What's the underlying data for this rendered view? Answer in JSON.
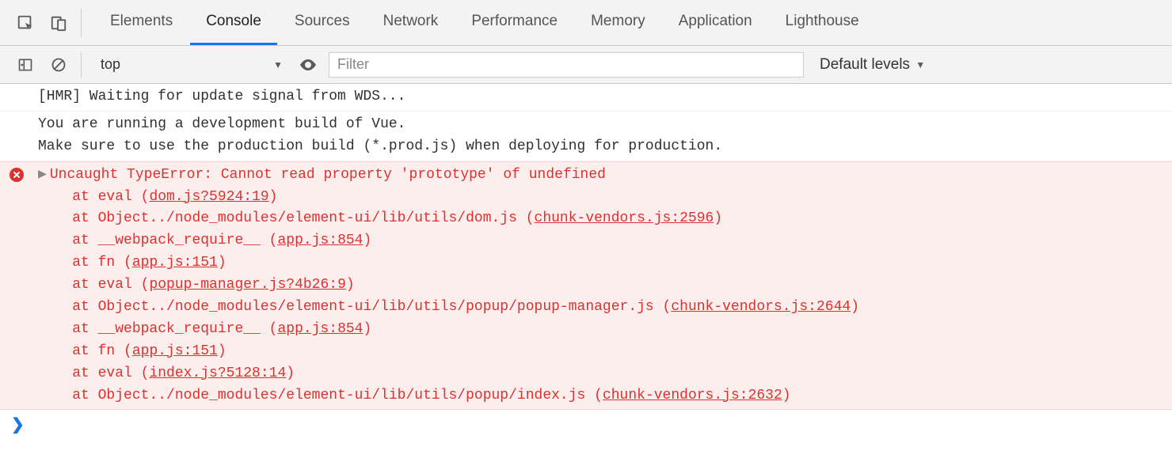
{
  "tabs": [
    "Elements",
    "Console",
    "Sources",
    "Network",
    "Performance",
    "Memory",
    "Application",
    "Lighthouse"
  ],
  "active_tab": "Console",
  "subbar": {
    "context": "top",
    "filter_placeholder": "Filter",
    "levels_label": "Default levels"
  },
  "logs": [
    {
      "type": "log",
      "lines": [
        "[HMR] Waiting for update signal from WDS..."
      ]
    },
    {
      "type": "log",
      "lines": [
        "You are running a development build of Vue.",
        "Make sure to use the production build (*.prod.js) when deploying for production."
      ]
    },
    {
      "type": "error",
      "header": "Uncaught TypeError: Cannot read property 'prototype' of undefined",
      "stack": [
        {
          "prefix": "at eval (",
          "link": "dom.js?5924:19",
          "suffix": ")"
        },
        {
          "prefix": "at Object../node_modules/element-ui/lib/utils/dom.js (",
          "link": "chunk-vendors.js:2596",
          "suffix": ")"
        },
        {
          "prefix": "at __webpack_require__ (",
          "link": "app.js:854",
          "suffix": ")"
        },
        {
          "prefix": "at fn (",
          "link": "app.js:151",
          "suffix": ")"
        },
        {
          "prefix": "at eval (",
          "link": "popup-manager.js?4b26:9",
          "suffix": ")"
        },
        {
          "prefix": "at Object../node_modules/element-ui/lib/utils/popup/popup-manager.js (",
          "link": "chunk-vendors.js:2644",
          "suffix": ")"
        },
        {
          "prefix": "at __webpack_require__ (",
          "link": "app.js:854",
          "suffix": ")"
        },
        {
          "prefix": "at fn (",
          "link": "app.js:151",
          "suffix": ")"
        },
        {
          "prefix": "at eval (",
          "link": "index.js?5128:14",
          "suffix": ")"
        },
        {
          "prefix": "at Object../node_modules/element-ui/lib/utils/popup/index.js (",
          "link": "chunk-vendors.js:2632",
          "suffix": ")"
        }
      ]
    }
  ]
}
